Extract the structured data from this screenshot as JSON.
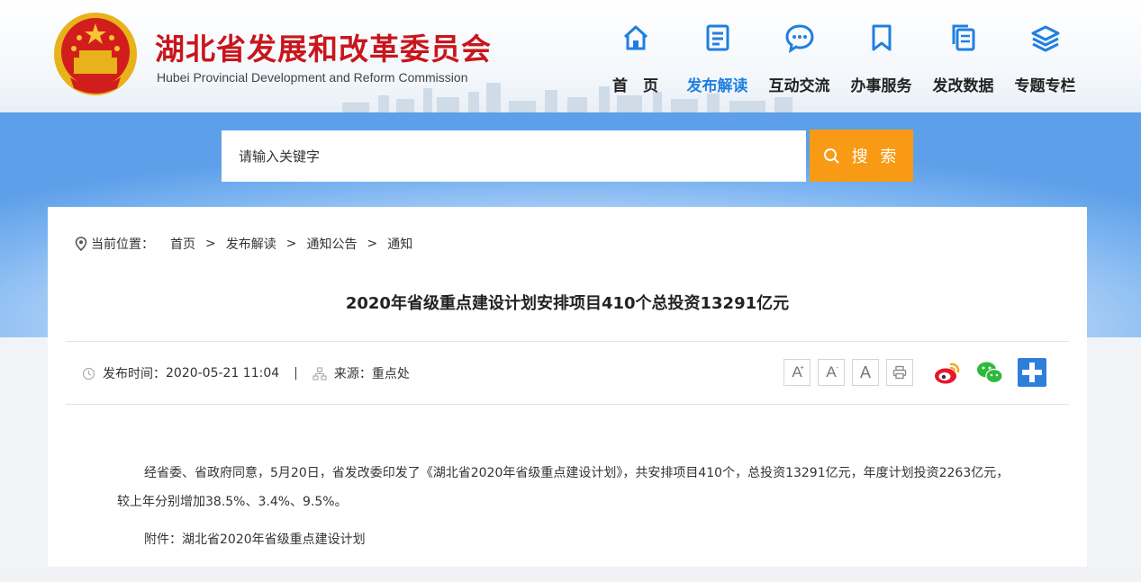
{
  "header": {
    "site_title": "湖北省发展和改革委员会",
    "site_subtitle": "Hubei Provincial Development and Reform Commission",
    "emblem_icon": "national-emblem-icon"
  },
  "nav": {
    "items": [
      {
        "label": "首　页",
        "icon": "home-icon"
      },
      {
        "label": "发布解读",
        "icon": "document-list-icon",
        "active": true
      },
      {
        "label": "互动交流",
        "icon": "chat-bubble-icon"
      },
      {
        "label": "办事服务",
        "icon": "bookmark-icon"
      },
      {
        "label": "发改数据",
        "icon": "data-pages-icon"
      },
      {
        "label": "专题专栏",
        "icon": "layers-icon"
      }
    ],
    "active_color": "#1f7fe0"
  },
  "search": {
    "placeholder": "请输入关键字",
    "button_label": "搜 索",
    "button_color": "#f89a14"
  },
  "breadcrumb": {
    "label": "当前位置：",
    "items": [
      "首页",
      "发布解读",
      "通知公告",
      "通知"
    ],
    "separator": ">"
  },
  "article": {
    "title": "2020年省级重点建设计划安排项目410个总投资13291亿元",
    "publish_label": "发布时间：",
    "publish_time": "2020-05-21 11:04",
    "source_label": "来源：",
    "source": "重点处",
    "paragraphs": [
      "经省委、省政府同意，5月20日，省发改委印发了《湖北省2020年省级重点建设计划》，共安排项目410个，总投资13291亿元，年度计划投资2263亿元，较上年分别增加38.5%、3.4%、9.5%。"
    ],
    "attachment": "附件：湖北省2020年省级重点建设计划"
  },
  "tools": {
    "font_large": "A",
    "font_small": "A",
    "font_default": "A"
  }
}
